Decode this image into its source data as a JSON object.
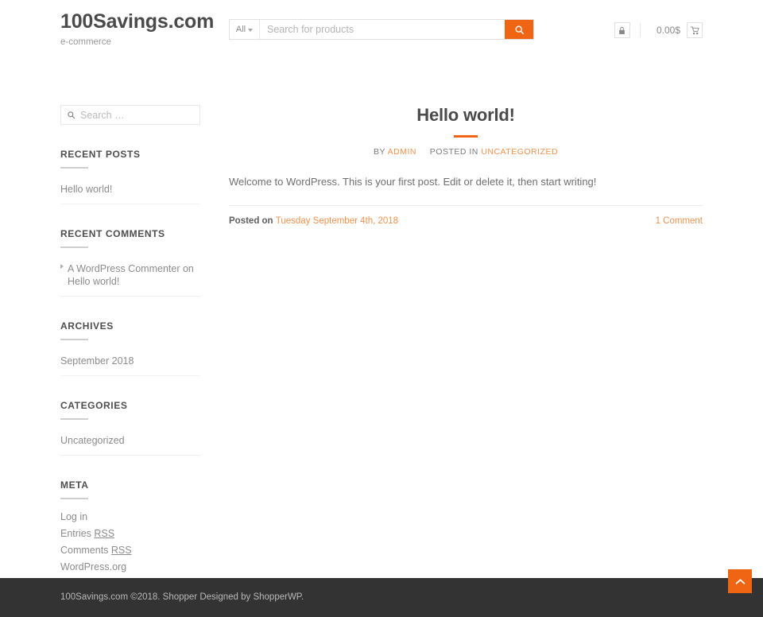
{
  "header": {
    "site_title": "100Savings.com",
    "tagline": "e-commerce",
    "product_search": {
      "category_label": "All",
      "placeholder": "Search for products",
      "value": "",
      "button_icon": "search-icon"
    },
    "tools": {
      "lock_icon": "lock-icon",
      "cart_total": "0.00$",
      "cart_icon": "cart-icon"
    }
  },
  "sidebar": {
    "search": {
      "placeholder": "Search …",
      "value": "",
      "icon": "search-icon"
    },
    "widgets": [
      {
        "title": "RECENT POSTS",
        "items": [
          {
            "label": "Hello world!"
          }
        ]
      },
      {
        "title": "RECENT COMMENTS",
        "items": [
          {
            "author": "A WordPress Commenter",
            "connector": "on",
            "post": "Hello world!"
          }
        ]
      },
      {
        "title": "ARCHIVES",
        "items": [
          {
            "label": "September 2018"
          }
        ]
      },
      {
        "title": "CATEGORIES",
        "items": [
          {
            "label": "Uncategorized"
          }
        ]
      },
      {
        "title": "META",
        "items": [
          {
            "label": "Log in"
          },
          {
            "label": "Entries ",
            "underlined": "RSS"
          },
          {
            "label": "Comments ",
            "underlined": "RSS"
          },
          {
            "label": "WordPress.org"
          }
        ]
      }
    ]
  },
  "main": {
    "post": {
      "title": "Hello world!",
      "meta_by_label": "BY",
      "meta_author": "ADMIN",
      "meta_posted_in_label": "POSTED IN",
      "meta_category": "UNCATEGORIZED",
      "content": "Welcome to WordPress. This is your first post. Edit or delete it, then start writing!",
      "posted_on_label": "Posted on",
      "posted_on_date": "Tuesday September 4th, 2018",
      "comments_link": "1 Comment"
    }
  },
  "footer": {
    "text": "100Savings.com ©2018. Shopper Designed by ShopperWP.",
    "to_top_icon": "chevron-up-icon"
  },
  "colors": {
    "accent": "#ef6513",
    "accent_light": "#f0924f",
    "footer_bg": "#333333",
    "heading": "#4a4a4a",
    "body_text": "#6f6f6f"
  }
}
